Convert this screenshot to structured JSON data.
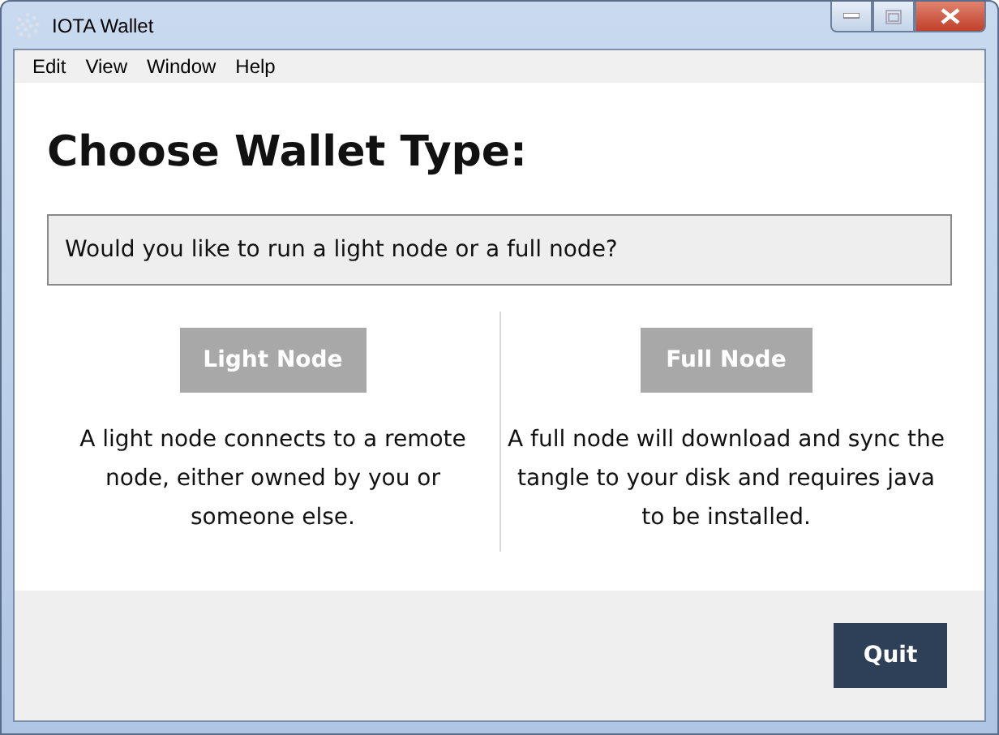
{
  "window": {
    "title": "IOTA Wallet"
  },
  "menu": [
    "Edit",
    "View",
    "Window",
    "Help"
  ],
  "heading": "Choose Wallet Type:",
  "question": "Would you like to run a light node or a full node?",
  "options": [
    {
      "button": "Light Node",
      "description": "A light node connects to a remote node, either owned by you or someone else."
    },
    {
      "button": "Full Node",
      "description": "A full node will download and sync the tangle to your disk and requires java to be installed."
    }
  ],
  "quit_button": "Quit"
}
